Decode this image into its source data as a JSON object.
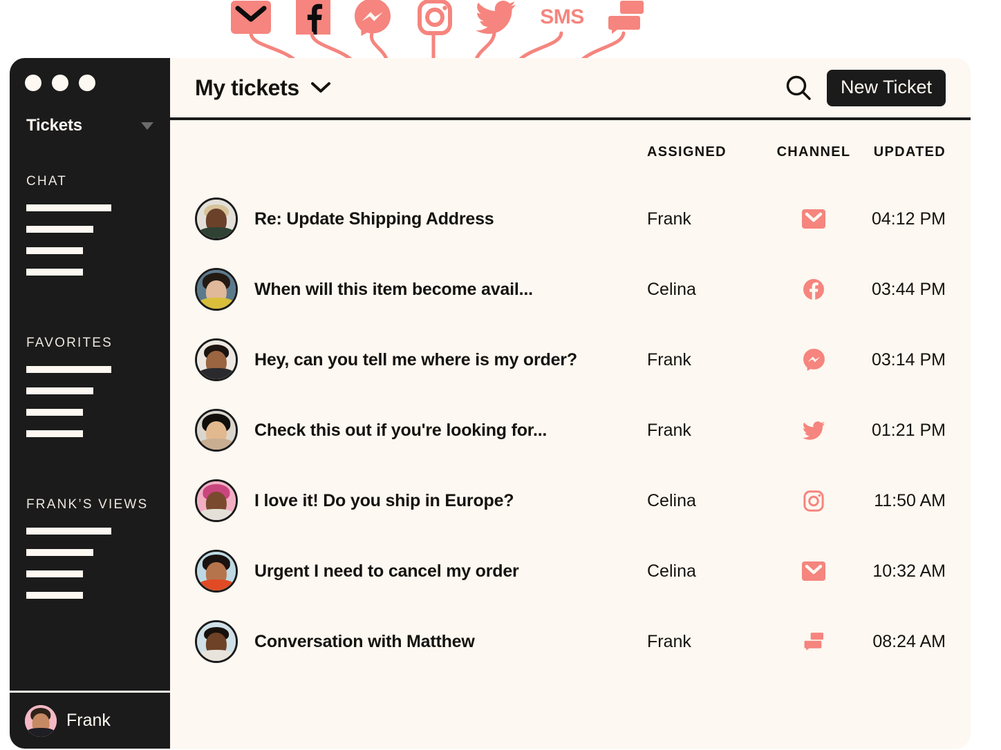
{
  "channel_strip": {
    "icons": [
      {
        "name": "email-icon",
        "label": "Email"
      },
      {
        "name": "facebook-icon",
        "label": "Facebook"
      },
      {
        "name": "messenger-icon",
        "label": "Messenger"
      },
      {
        "name": "instagram-icon",
        "label": "Instagram"
      },
      {
        "name": "twitter-icon",
        "label": "Twitter"
      },
      {
        "name": "sms-icon",
        "label": "SMS"
      },
      {
        "name": "chat-icon",
        "label": "Chat"
      }
    ],
    "sms_label": "SMS"
  },
  "sidebar": {
    "title": "Tickets",
    "sections": [
      {
        "heading": "CHAT",
        "placeholder_count": 4
      },
      {
        "heading": "FAVORITES",
        "placeholder_count": 4
      },
      {
        "heading": "FRANK’S VIEWS",
        "placeholder_count": 4
      }
    ],
    "footer": {
      "username": "Frank"
    }
  },
  "header": {
    "title": "My tickets",
    "search_label": "Search",
    "new_ticket_label": "New Ticket"
  },
  "table": {
    "columns": {
      "subject": "",
      "assigned": "ASSIGNED",
      "channel": "CHANNEL",
      "updated": "UPDATED"
    },
    "rows": [
      {
        "subject": "Re: Update Shipping Address",
        "assigned": "Frank",
        "channel": "email",
        "updated": "04:12 PM"
      },
      {
        "subject": "When will this item become avail...",
        "assigned": "Celina",
        "channel": "facebook",
        "updated": "03:44 PM"
      },
      {
        "subject": "Hey, can you tell me where is my order?",
        "assigned": "Frank",
        "channel": "messenger",
        "updated": "03:14 PM"
      },
      {
        "subject": "Check this out if you're looking for...",
        "assigned": "Frank",
        "channel": "twitter",
        "updated": "01:21 PM"
      },
      {
        "subject": "I love it! Do you ship in Europe?",
        "assigned": "Celina",
        "channel": "instagram",
        "updated": "11:50 AM"
      },
      {
        "subject": "Urgent I need to cancel my order",
        "assigned": "Celina",
        "channel": "email",
        "updated": "10:32 AM"
      },
      {
        "subject": "Conversation with Matthew",
        "assigned": "Frank",
        "channel": "chat",
        "updated": "08:24 AM"
      }
    ]
  },
  "colors": {
    "accent": "#F5857E",
    "dark": "#1B1B1B",
    "cream": "#FDF8F1",
    "text": "#15130F"
  }
}
